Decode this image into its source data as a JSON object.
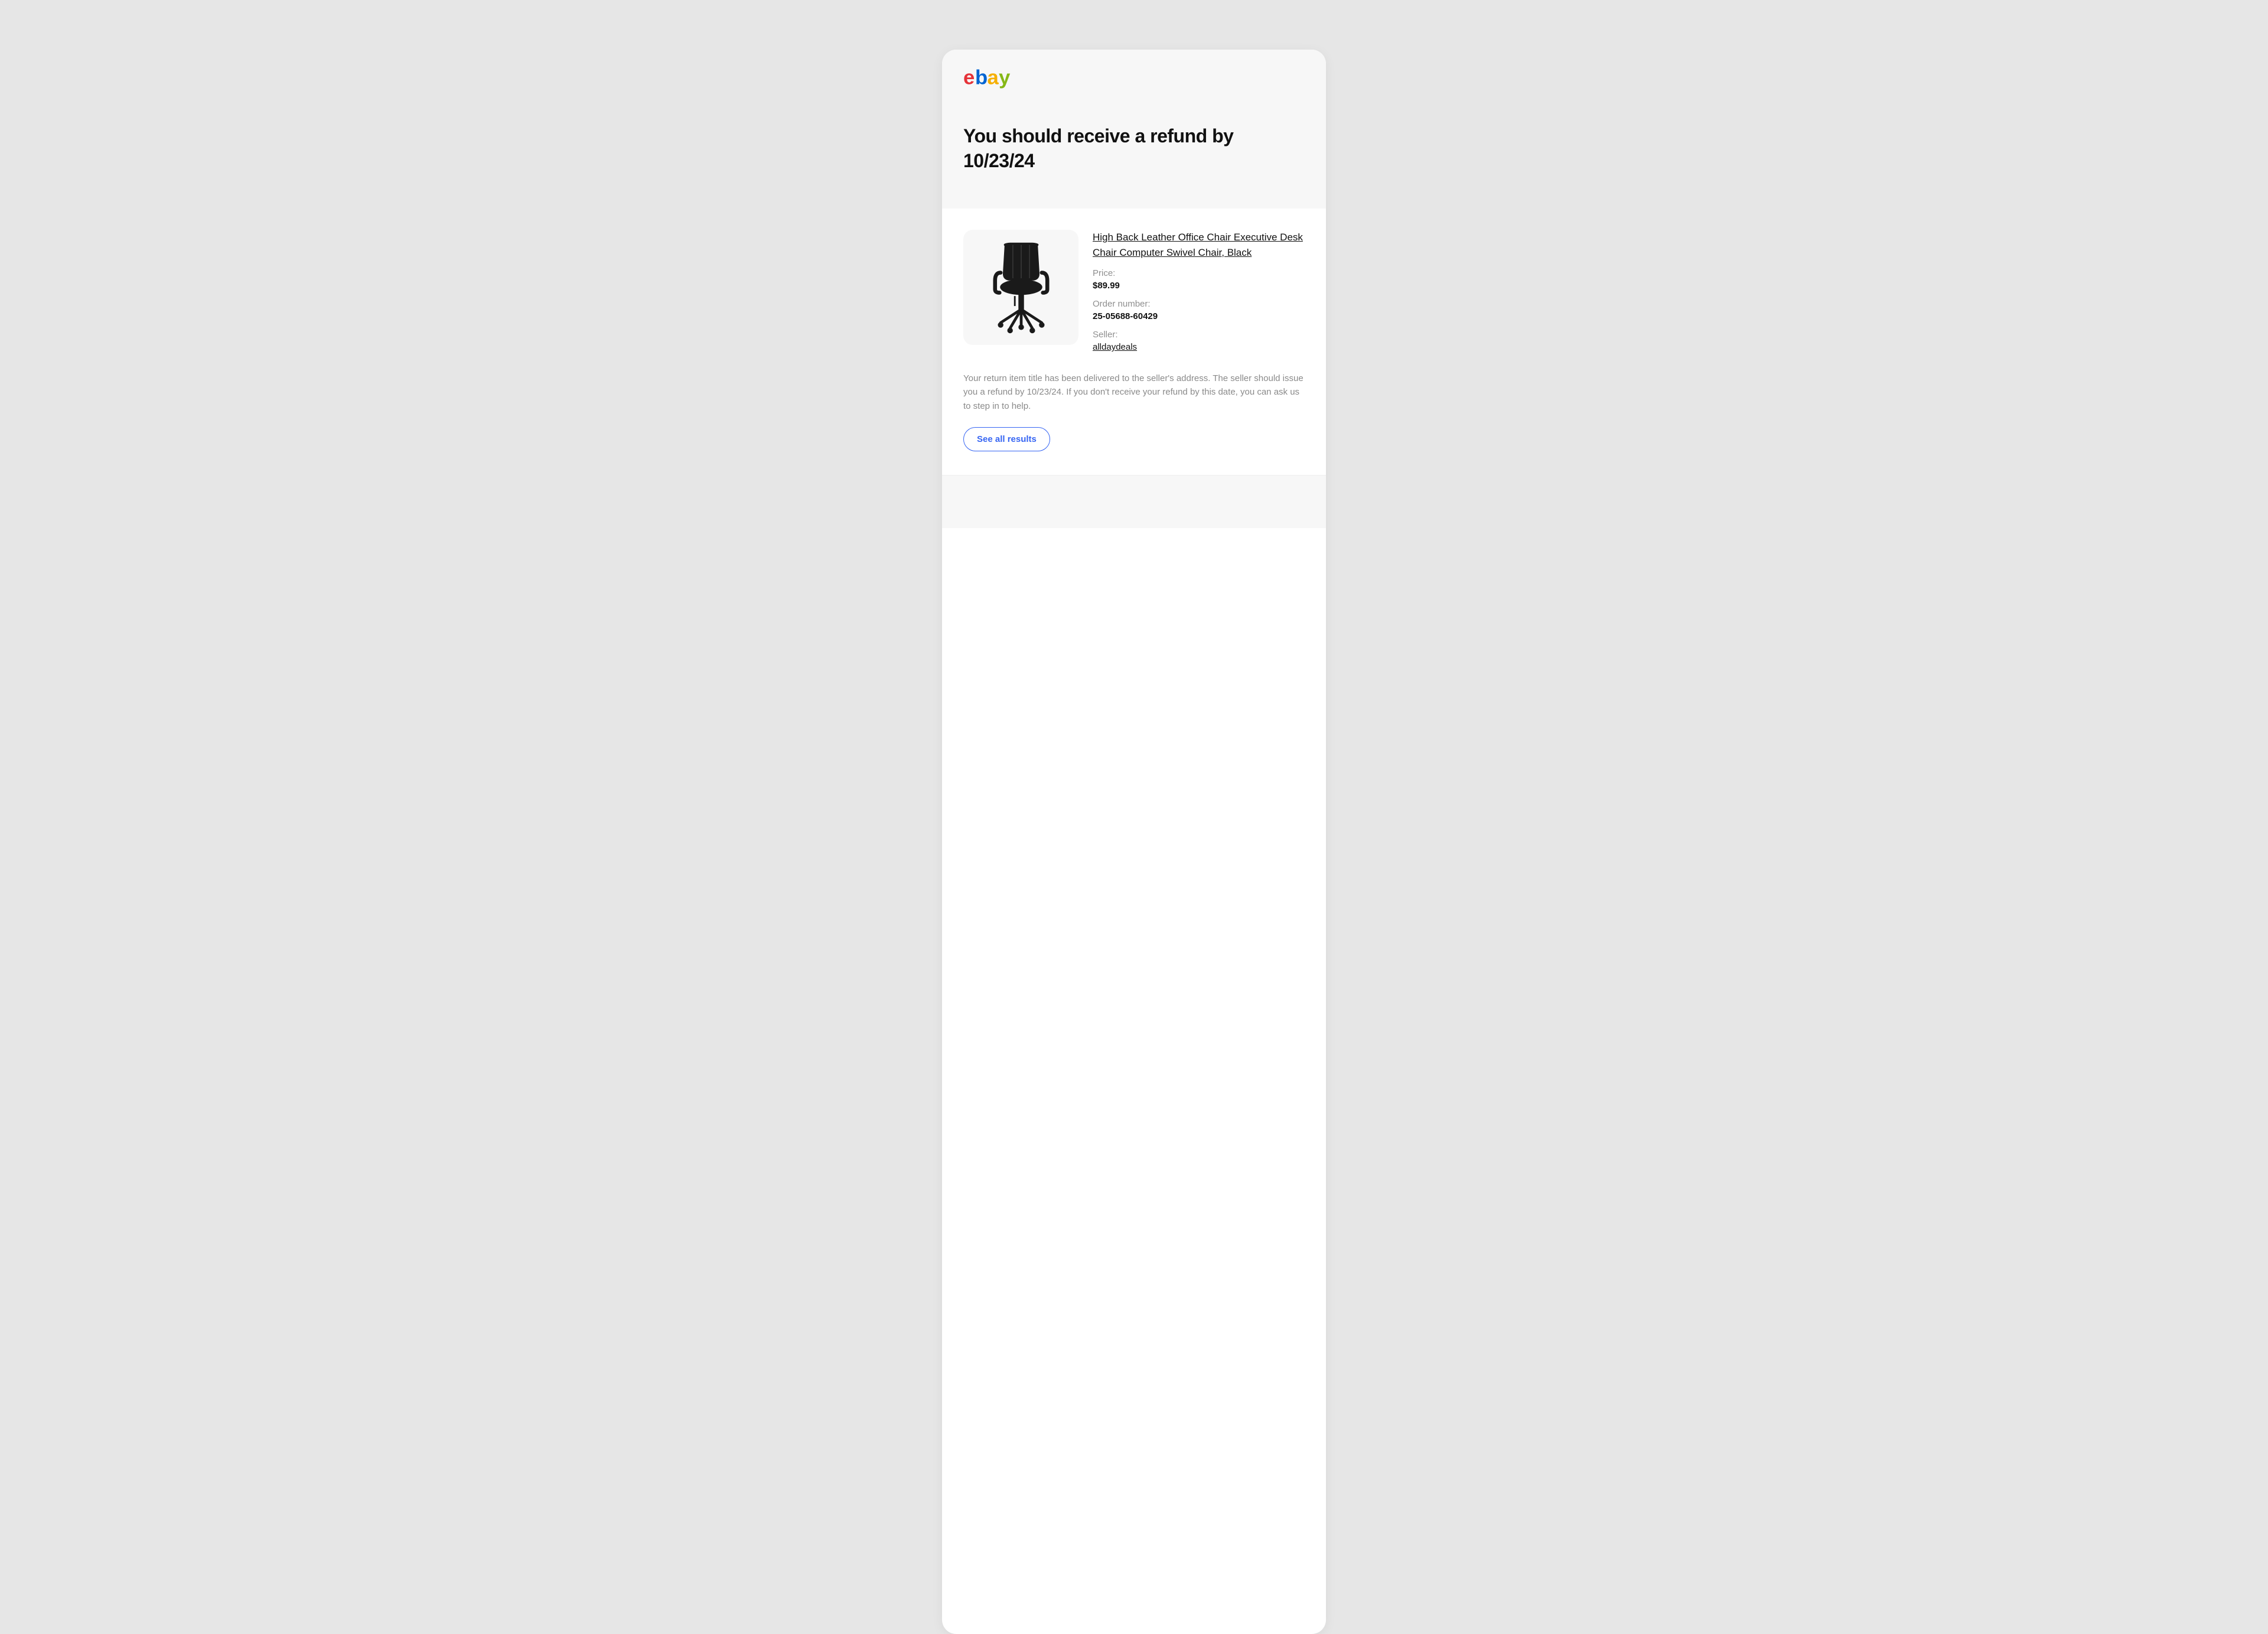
{
  "headline": "You should receive a refund by 10/23/24",
  "product": {
    "title": "High Back Leather Office Chair Executive Desk Chair Computer Swivel Chair, Black",
    "price_label": "Price:",
    "price_value": "$89.99",
    "order_label": "Order number:",
    "order_value": "25-05688-60429",
    "seller_label": "Seller:",
    "seller_name": "alldaydeals"
  },
  "message": "Your return item title has been delivered to the seller's address. The seller should issue you a refund by 10/23/24. If you don't receive your refund by this date, you can ask us to step in to help.",
  "cta_label": "See all results"
}
